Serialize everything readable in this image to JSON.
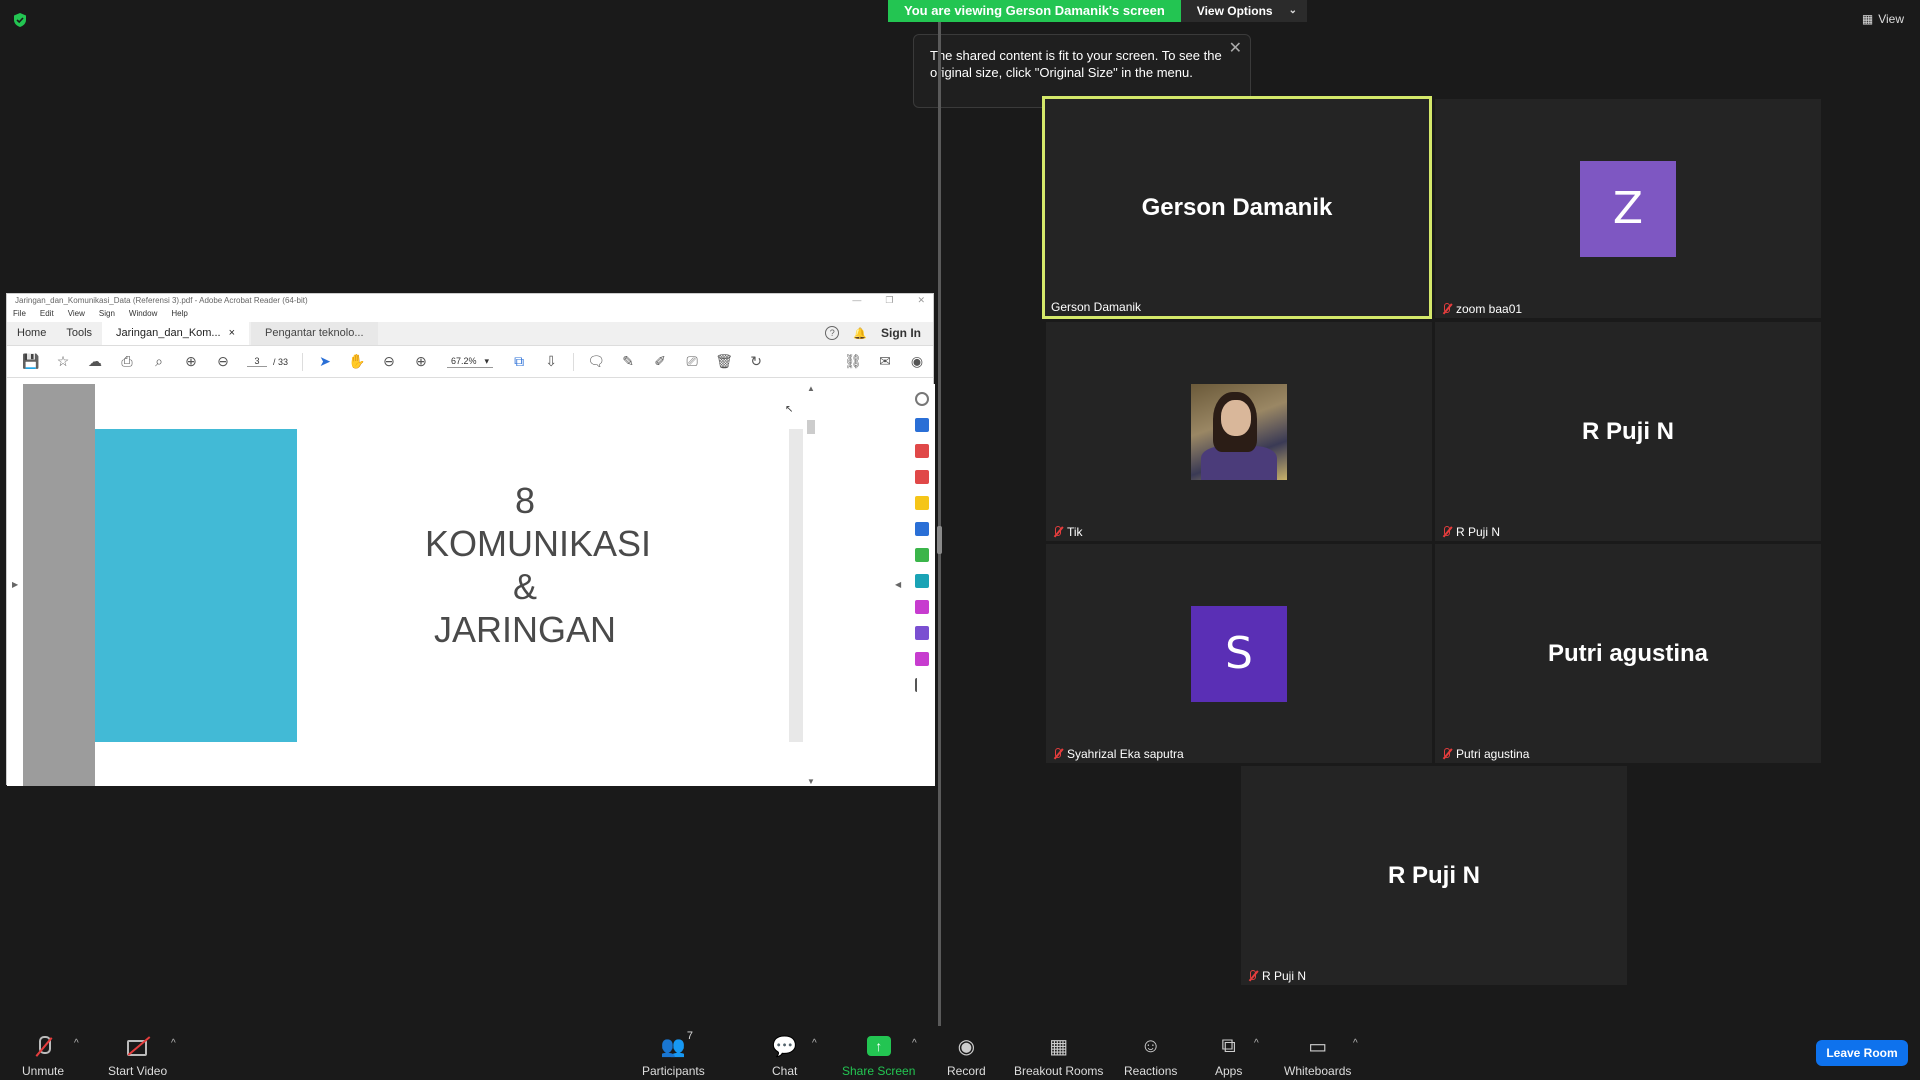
{
  "banner": {
    "viewing_text": "You are viewing Gerson Damanik's screen",
    "view_options": "View Options"
  },
  "tooltip": {
    "message": "The shared content is fit to your screen. To see the original size, click \"Original Size\" in the menu."
  },
  "view_button": "View",
  "acrobat": {
    "title": "Jaringan_dan_Komunikasi_Data (Referensi 3).pdf - Adobe Acrobat Reader (64-bit)",
    "menu": [
      "File",
      "Edit",
      "View",
      "Sign",
      "Window",
      "Help"
    ],
    "nav_tabs": [
      "Home",
      "Tools"
    ],
    "doc_tabs": [
      "Jaringan_dan_Kom...",
      "Pengantar teknolo..."
    ],
    "sign_in": "Sign In",
    "page_current": "3",
    "page_total": "/ 33",
    "zoom": "67.2%",
    "slide": {
      "line1": "8",
      "line2": "KOMUNIKASI",
      "line3": "&",
      "line4": "JARINGAN"
    }
  },
  "tiles": [
    {
      "name": "Gerson Damanik",
      "big": "Gerson Damanik",
      "muted": false,
      "active": true
    },
    {
      "name": "zoom baa01",
      "avatar_letter": "Z",
      "avatar_color": "#7e57c2",
      "muted": true
    },
    {
      "name": "Tik",
      "muted": true,
      "photo": true
    },
    {
      "name": "R Puji N",
      "big": "R Puji N",
      "muted": true
    },
    {
      "name": "Syahrizal Eka saputra",
      "avatar_letter": "S",
      "avatar_color": "#5a2fb5",
      "muted": true
    },
    {
      "name": "Putri agustina",
      "big": "Putri agustina",
      "muted": true
    },
    {
      "name": "R Puji N",
      "big": "R Puji N",
      "muted": true
    }
  ],
  "toolbar": {
    "unmute": "Unmute",
    "start_video": "Start Video",
    "participants": "Participants",
    "participants_count": "7",
    "chat": "Chat",
    "share_screen": "Share Screen",
    "record": "Record",
    "breakout_rooms": "Breakout Rooms",
    "reactions": "Reactions",
    "apps": "Apps",
    "whiteboards": "Whiteboards",
    "leave_room": "Leave Room"
  },
  "colors": {
    "share_green": "#23c552",
    "leave_blue": "#0e72ed",
    "active_speaker": "#d4e86a",
    "slide_teal": "#42bad6",
    "muted_red": "#e53d3d"
  }
}
